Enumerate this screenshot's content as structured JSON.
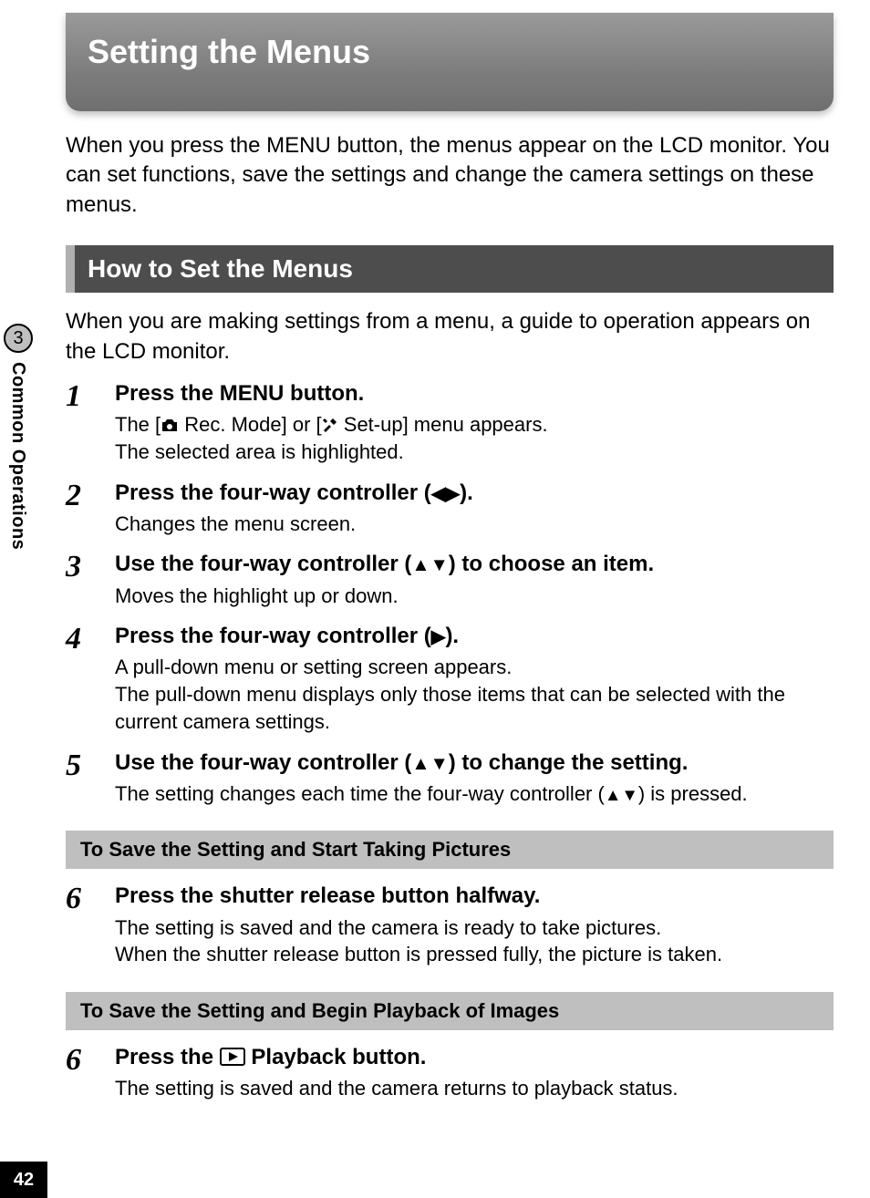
{
  "page_number": "42",
  "side_tab": {
    "chapter_number": "3",
    "label": "Common Operations"
  },
  "title": "Setting the Menus",
  "intro": "When you press the MENU button, the menus appear on the LCD monitor. You can set functions, save the settings and change the camera settings on these menus.",
  "section_heading": "How to Set the Menus",
  "section_intro": "When you are making settings from a menu, a guide to operation appears on the LCD monitor.",
  "steps": [
    {
      "num": "1",
      "title": "Press the MENU button.",
      "desc_parts": [
        "The [",
        " Rec. Mode] or [",
        " Set-up] menu appears.\nThe selected area is highlighted."
      ],
      "icons": [
        "camera",
        "tools"
      ]
    },
    {
      "num": "2",
      "title_parts": [
        "Press the four-way controller (",
        "◀▶",
        ")."
      ],
      "desc": "Changes the menu screen."
    },
    {
      "num": "3",
      "title_parts": [
        "Use the four-way controller (",
        "▲▼",
        ") to choose an item."
      ],
      "desc": "Moves the highlight up or down."
    },
    {
      "num": "4",
      "title_parts": [
        "Press the four-way controller (",
        "▶",
        ")."
      ],
      "desc": "A pull-down menu or setting screen appears.\nThe pull-down menu displays only those items that can be selected with the current camera settings."
    },
    {
      "num": "5",
      "title_parts": [
        "Use the four-way controller (",
        "▲▼",
        ") to change the setting."
      ],
      "desc_parts": [
        "The setting changes each time the four-way controller (",
        "▲▼",
        ") is pressed."
      ]
    }
  ],
  "sub1": "To Save the Setting and Start Taking Pictures",
  "step6a": {
    "num": "6",
    "title": "Press the shutter release button halfway.",
    "desc": "The setting is saved and the camera is ready to take pictures.\nWhen the shutter release button is pressed fully, the picture is taken."
  },
  "sub2": "To Save the Setting and Begin Playback of Images",
  "step6b": {
    "num": "6",
    "title_parts": [
      "Press the ",
      " Playback button."
    ],
    "icon": "playback",
    "desc": "The setting is saved and the camera returns to playback status."
  }
}
